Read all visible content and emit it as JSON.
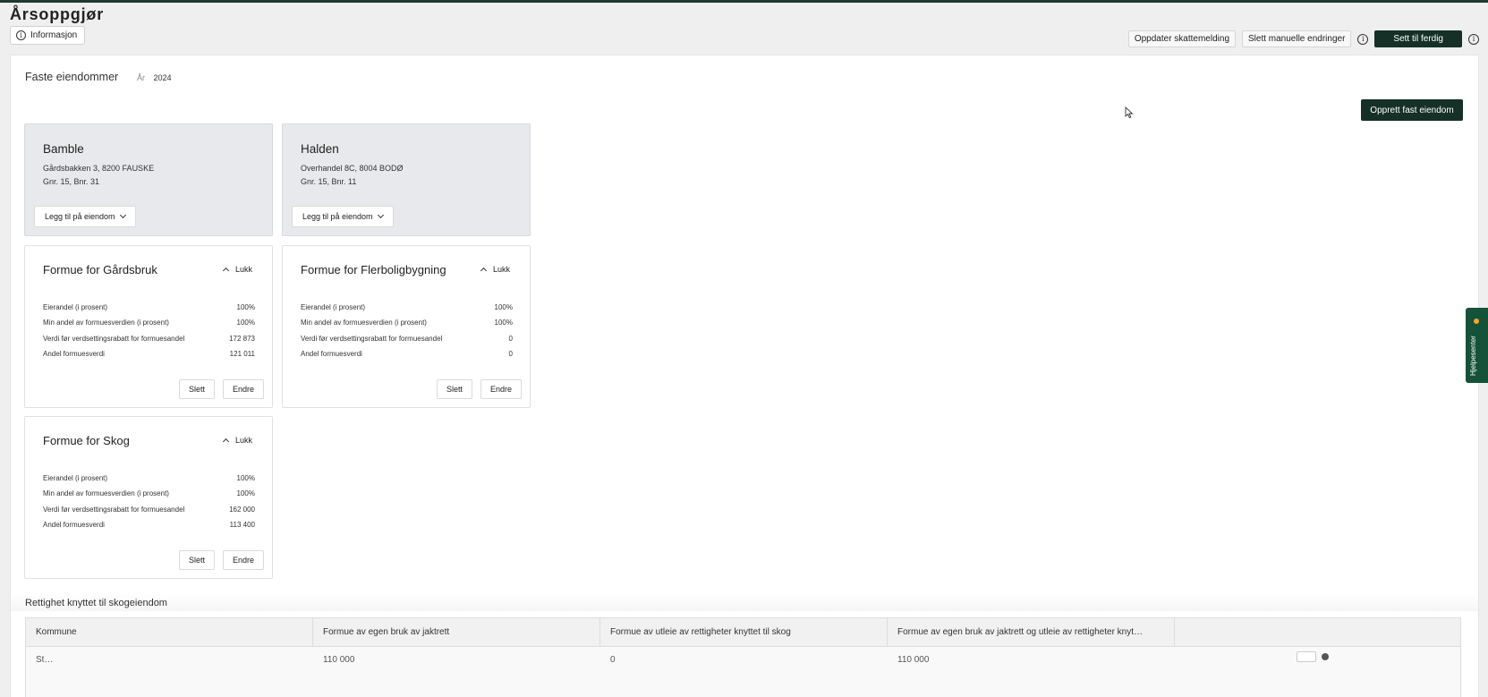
{
  "page": {
    "title": "Årsoppgjør",
    "info_label": "Informasjon"
  },
  "actions": {
    "update_label": "Oppdater skattemelding",
    "delete_manual_label": "Slett manuelle endringer",
    "finish_label": "Sett til ferdig"
  },
  "section": {
    "title": "Faste eiendommer",
    "year_label": "År",
    "year_value": "2024",
    "create_label": "Opprett fast eiendom"
  },
  "properties": [
    {
      "name": "Bamble",
      "address": "Gårdsbakken 3, 8200 FAUSKE",
      "gnr": "Gnr. 15, Bnr. 31",
      "add_label": "Legg til på eiendom"
    },
    {
      "name": "Halden",
      "address": "Overhandel 8C, 8004 BODØ",
      "gnr": "Gnr. 15, Bnr. 11",
      "add_label": "Legg til på eiendom"
    }
  ],
  "formue_cards": [
    {
      "title": "Formue for Gårdsbruk",
      "toggle_label": "Lukk",
      "rows": [
        {
          "label": "Eierandel (i prosent)",
          "value": "100%"
        },
        {
          "label": "Min andel av formuesverdien (i prosent)",
          "value": "100%"
        },
        {
          "label": "Verdi før verdsettingsrabatt for formuesandel",
          "value": "172 873"
        },
        {
          "label": "Andel formuesverdi",
          "value": "121 011"
        }
      ],
      "delete_label": "Slett",
      "edit_label": "Endre"
    },
    {
      "title": "Formue for Flerboligbygning",
      "toggle_label": "Lukk",
      "rows": [
        {
          "label": "Eierandel (i prosent)",
          "value": "100%"
        },
        {
          "label": "Min andel av formuesverdien (i prosent)",
          "value": "100%"
        },
        {
          "label": "Verdi før verdsettingsrabatt for formuesandel",
          "value": "0"
        },
        {
          "label": "Andel formuesverdi",
          "value": "0"
        }
      ],
      "delete_label": "Slett",
      "edit_label": "Endre"
    },
    {
      "title": "Formue for Skog",
      "toggle_label": "Lukk",
      "rows": [
        {
          "label": "Eierandel (i prosent)",
          "value": "100%"
        },
        {
          "label": "Min andel av formuesverdien (i prosent)",
          "value": "100%"
        },
        {
          "label": "Verdi før verdsettingsrabatt for formuesandel",
          "value": "162 000"
        },
        {
          "label": "Andel formuesverdi",
          "value": "113 400"
        }
      ],
      "delete_label": "Slett",
      "edit_label": "Endre"
    }
  ],
  "rights_table": {
    "title": "Rettighet knyttet til skogeiendom",
    "headers": [
      "Kommune",
      "Formue av egen bruk av jaktrett",
      "Formue av utleie av rettigheter knyttet til skog",
      "Formue av egen bruk av jaktrett og utleie av rettigheter knyt…"
    ],
    "row": [
      "St…",
      "110 000",
      "0",
      "110 000"
    ]
  },
  "help_tab": {
    "label": "Hjelpesenter"
  }
}
